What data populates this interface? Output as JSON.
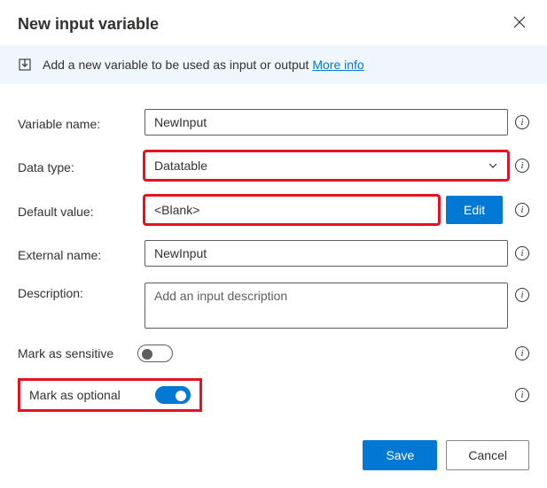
{
  "header": {
    "title": "New input variable"
  },
  "banner": {
    "text": "Add a new variable to be used as input or output ",
    "link_label": "More info"
  },
  "fields": {
    "variable_name": {
      "label": "Variable name:",
      "value": "NewInput"
    },
    "data_type": {
      "label": "Data type:",
      "value": "Datatable"
    },
    "default_value": {
      "label": "Default value:",
      "value": "<Blank>",
      "edit_label": "Edit"
    },
    "external_name": {
      "label": "External name:",
      "value": "NewInput"
    },
    "description": {
      "label": "Description:",
      "placeholder": "Add an input description"
    },
    "sensitive": {
      "label": "Mark as sensitive",
      "on": false
    },
    "optional": {
      "label": "Mark as optional",
      "on": true
    }
  },
  "footer": {
    "save": "Save",
    "cancel": "Cancel"
  }
}
